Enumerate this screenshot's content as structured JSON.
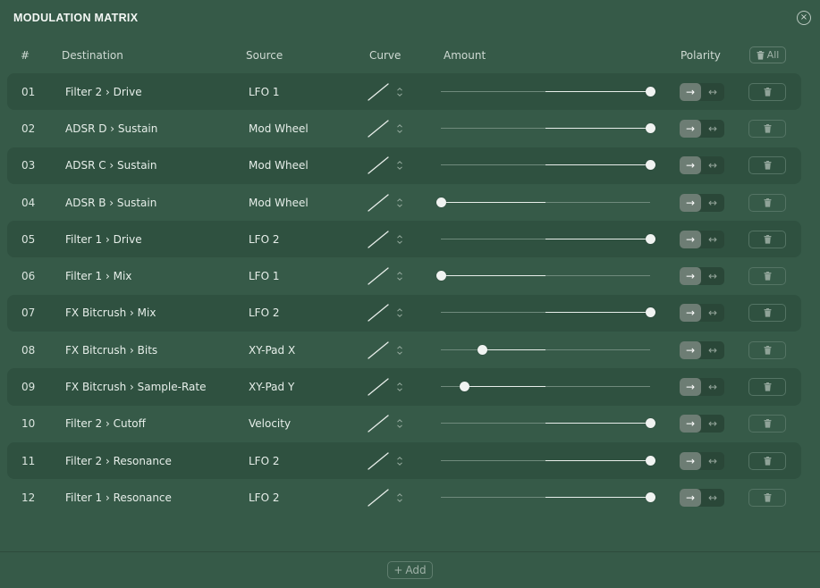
{
  "title": "MODULATION MATRIX",
  "close_icon": "×",
  "columns": {
    "num": "#",
    "destination": "Destination",
    "source": "Source",
    "curve": "Curve",
    "amount": "Amount",
    "polarity": "Polarity",
    "delete_all": "All"
  },
  "rows": [
    {
      "num": "01",
      "destination": "Filter 2 › Drive",
      "source": "LFO 1",
      "amount": 1.0,
      "polarity": "unipolar"
    },
    {
      "num": "02",
      "destination": "ADSR D › Sustain",
      "source": "Mod Wheel",
      "amount": 1.0,
      "polarity": "unipolar"
    },
    {
      "num": "03",
      "destination": "ADSR C › Sustain",
      "source": "Mod Wheel",
      "amount": 1.0,
      "polarity": "unipolar"
    },
    {
      "num": "04",
      "destination": "ADSR B › Sustain",
      "source": "Mod Wheel",
      "amount": -1.0,
      "polarity": "unipolar"
    },
    {
      "num": "05",
      "destination": "Filter 1 › Drive",
      "source": "LFO 2",
      "amount": 1.0,
      "polarity": "unipolar"
    },
    {
      "num": "06",
      "destination": "Filter 1 › Mix",
      "source": "LFO 1",
      "amount": -1.0,
      "polarity": "unipolar"
    },
    {
      "num": "07",
      "destination": "FX Bitcrush › Mix",
      "source": "LFO 2",
      "amount": 1.0,
      "polarity": "unipolar"
    },
    {
      "num": "08",
      "destination": "FX Bitcrush › Bits",
      "source": "XY-Pad X",
      "amount": -0.6,
      "polarity": "unipolar"
    },
    {
      "num": "09",
      "destination": "FX Bitcrush › Sample-Rate",
      "source": "XY-Pad Y",
      "amount": -0.77,
      "polarity": "unipolar"
    },
    {
      "num": "10",
      "destination": "Filter 2 › Cutoff",
      "source": "Velocity",
      "amount": 1.0,
      "polarity": "unipolar"
    },
    {
      "num": "11",
      "destination": "Filter 2 › Resonance",
      "source": "LFO 2",
      "amount": 1.0,
      "polarity": "unipolar"
    },
    {
      "num": "12",
      "destination": "Filter 1 › Resonance",
      "source": "LFO 2",
      "amount": 1.0,
      "polarity": "unipolar"
    }
  ],
  "polarity_icons": {
    "unipolar": "→",
    "bipolar": "↔"
  },
  "footer": {
    "add_label": "Add",
    "add_icon": "+"
  },
  "colors": {
    "background": "#365a48",
    "row_alt": "#2f5140",
    "accent": "#f0f3f1"
  }
}
